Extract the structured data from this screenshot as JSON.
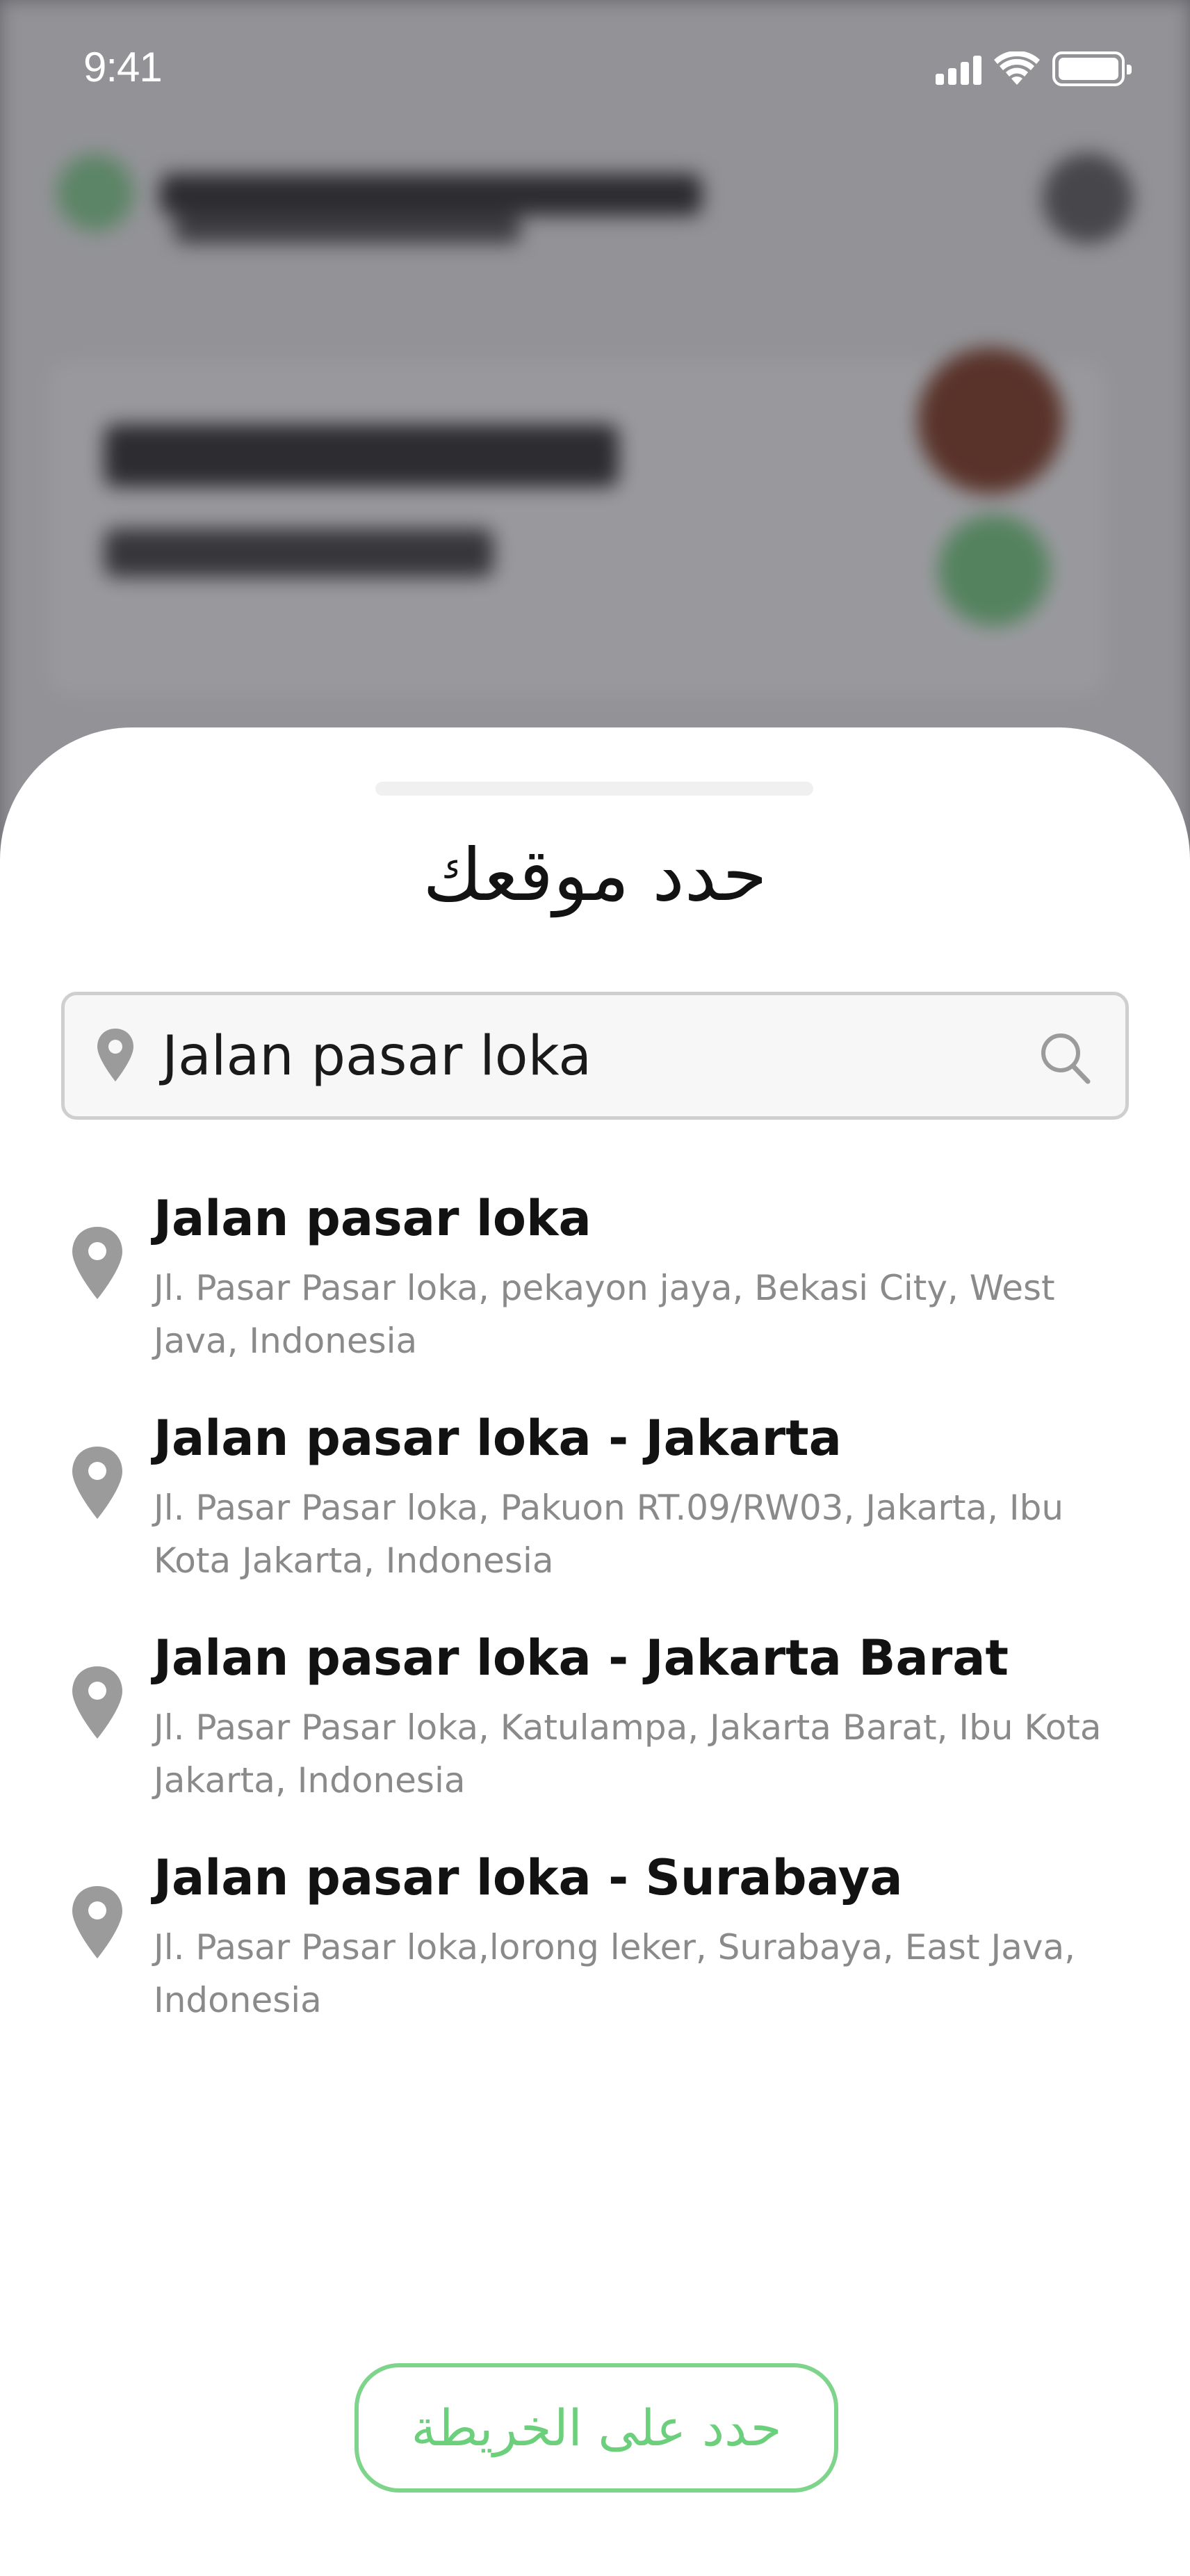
{
  "status_bar": {
    "time": "9:41"
  },
  "sheet": {
    "title": "حدد موقعك",
    "search": {
      "value": "Jalan pasar loka"
    },
    "results": [
      {
        "title": "Jalan pasar loka",
        "address": "Jl. Pasar Pasar loka, pekayon jaya, Bekasi City, West Java, Indonesia"
      },
      {
        "title": "Jalan pasar loka - Jakarta",
        "address": "Jl. Pasar Pasar loka, Pakuon RT.09/RW03, Jakarta, Ibu Kota Jakarta, Indonesia"
      },
      {
        "title": "Jalan pasar loka - Jakarta Barat",
        "address": "Jl. Pasar Pasar loka, Katulampa, Jakarta Barat, Ibu Kota Jakarta, Indonesia"
      },
      {
        "title": "Jalan pasar loka - Surabaya",
        "address": "Jl. Pasar Pasar loka,lorong leker, Surabaya, East Java, Indonesia"
      }
    ],
    "map_button_label": "حدد على الخريطة"
  },
  "colors": {
    "accent": "#7fd48c",
    "pin": "#9b9b9b",
    "overlay": "#8e8e93"
  },
  "icons": {
    "search_pin": "location-pin-icon",
    "search": "search-icon",
    "result_pin": "location-pin-icon"
  }
}
